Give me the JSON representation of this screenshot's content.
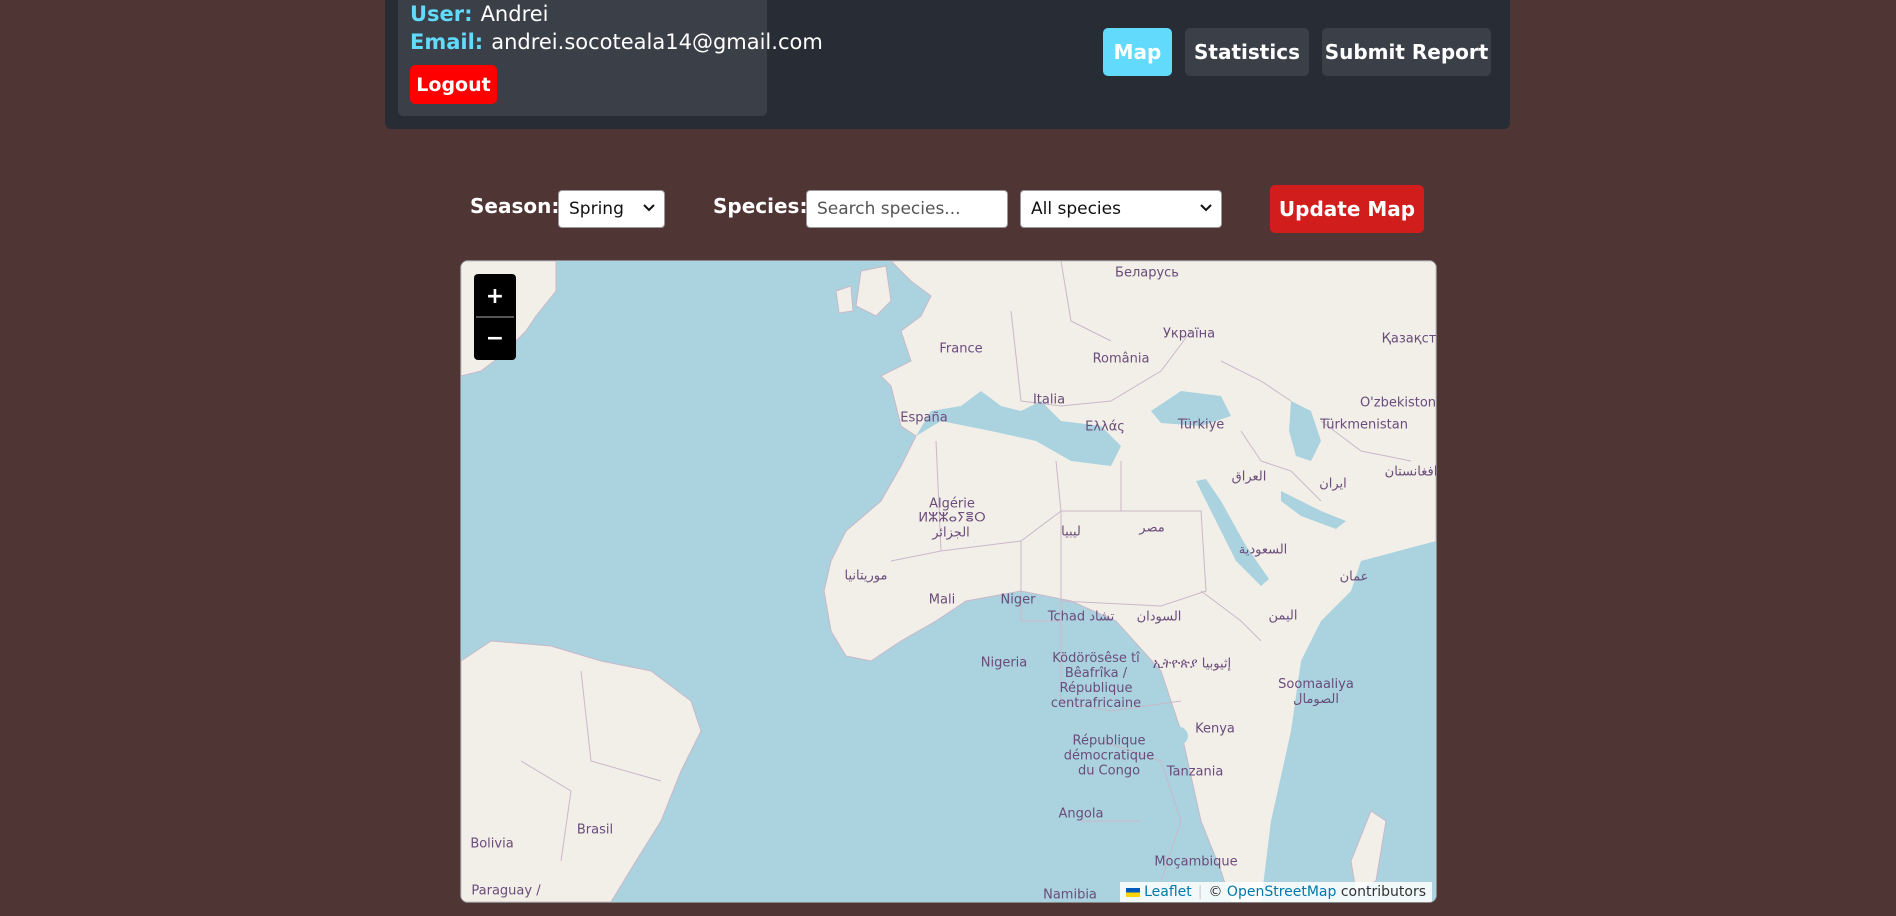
{
  "user": {
    "user_label": "User:",
    "user_value": "Andrei",
    "email_label": "Email:",
    "email_value": "andrei.socoteala14@gmail.com",
    "logout_label": "Logout"
  },
  "nav": {
    "map_label": "Map",
    "statistics_label": "Statistics",
    "submit_report_label": "Submit Report",
    "active": "Map"
  },
  "controls": {
    "season_label": "Season:",
    "season_value": "Spring",
    "species_label": "Species:",
    "species_placeholder": "Search species...",
    "species_select_value": "All species",
    "update_label": "Update Map"
  },
  "map": {
    "zoom_in": "+",
    "zoom_out": "−",
    "attribution": {
      "leaflet": "Leaflet",
      "copyright": "©",
      "osm": "OpenStreetMap",
      "contributors": "contributors"
    },
    "labels": [
      "Беларусь",
      "Україна",
      "Қазақст",
      "France",
      "România",
      "España",
      "Italia",
      "Ελλάς",
      "Türkiye",
      "O'zbekiston",
      "Türkmenistan",
      "افغانستان",
      "العراق",
      "ایران",
      "Algérie",
      "ⵍⵣⵣⴰⵢⴻⵔ",
      "الجزائر",
      "ليبيا",
      "مصر",
      "السعودية",
      "عمان",
      "موريتانيا",
      "Mali",
      "Niger",
      "Tchad تشاد",
      "السودان",
      "اليمن",
      "Nigeria",
      "Ködörösêse tî Bêafrîka / République centrafricaine",
      "ኢትዮጵያ إثيوبيا",
      "Soomaaliya الصومال",
      "Kenya",
      "République démocratique du Congo",
      "Tanzania",
      "Angola",
      "Brasil",
      "Bolivia",
      "Paraguay /",
      "Moçambique",
      "Namibia"
    ]
  },
  "colors": {
    "background": "#503535",
    "header": "#282c34",
    "accent": "#61dafb",
    "logout": "#ff0000",
    "update": "#d21d1d",
    "sea": "#aad3df",
    "land": "#f2efe9"
  }
}
